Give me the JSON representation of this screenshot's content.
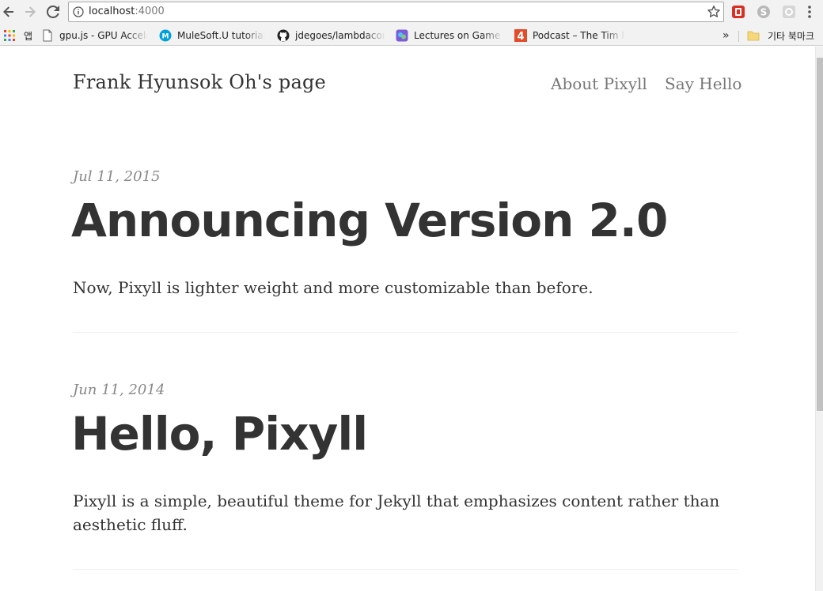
{
  "browser": {
    "url_host": "localhost",
    "url_port": ":4000",
    "bookmarks": [
      {
        "label": "앱",
        "icon": "apps-grid-icon"
      },
      {
        "label": "gpu.js - GPU Acceler",
        "icon": "page-icon"
      },
      {
        "label": "MuleSoft.U tutorials",
        "icon": "mulesoft-icon"
      },
      {
        "label": "jdegoes/lambdaconf",
        "icon": "github-icon"
      },
      {
        "label": "Lectures on Game Pr",
        "icon": "lectures-icon"
      },
      {
        "label": "Podcast – The Tim F",
        "icon": "podcast-4-icon"
      },
      {
        "label": "기타 북마크",
        "icon": "folder-icon"
      }
    ],
    "overflow_label": "»",
    "podcast_icon_text": "4"
  },
  "site": {
    "title": "Frank Hyunsok Oh's page",
    "nav": [
      "About Pixyll",
      "Say Hello"
    ]
  },
  "posts": [
    {
      "date": "Jul 11, 2015",
      "title": "Announcing Version 2.0",
      "summary": "Now, Pixyll is lighter weight and more customizable than before."
    },
    {
      "date": "Jun 11, 2014",
      "title": "Hello, Pixyll",
      "summary": "Pixyll is a simple, beautiful theme for Jekyll that emphasizes content rather than aesthetic fluff."
    }
  ],
  "colors": {
    "text": "#333333",
    "muted": "#888888",
    "nav": "#777777",
    "chrome": "#f2f2f2"
  }
}
